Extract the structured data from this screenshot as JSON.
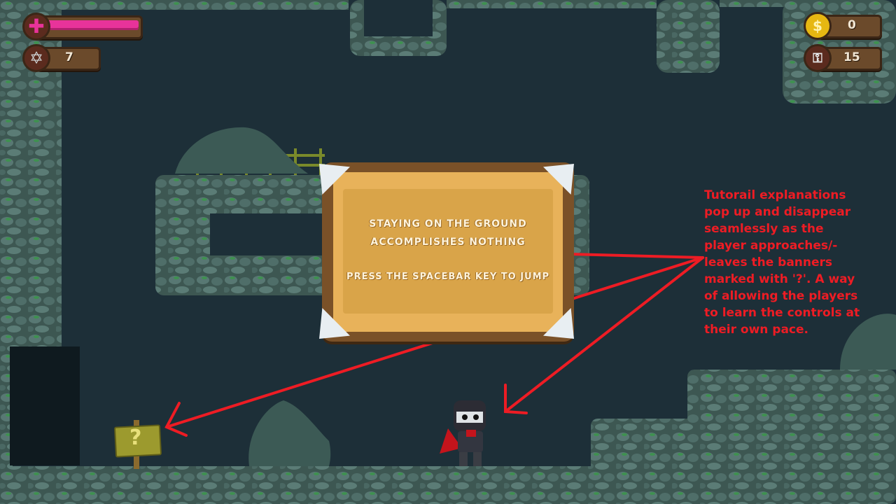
{
  "hud": {
    "health": {
      "icon": "plus-icon",
      "level": 1.0,
      "color": "#e8339a"
    },
    "shuriken": {
      "icon": "shuriken-icon",
      "count": "7"
    },
    "coins": {
      "icon": "coin-icon",
      "symbol": "$",
      "count": "0"
    },
    "keys": {
      "icon": "key-icon",
      "count": "15"
    }
  },
  "tutorial_banner": {
    "line1": "STAYING ON THE GROUND",
    "line2": "ACCOMPLISHES NOTHING",
    "line3": "PRESS THE SPACEBAR KEY TO JUMP"
  },
  "help_sign": {
    "symbol": "?"
  },
  "annotation": {
    "text": "Tutorail explanations\npop up and disappear\nseamlessly as the\nplayer approaches/-\nleaves the banners\nmarked with '?'. A way\nof allowing the players\nto learn the controls at\ntheir own pace.",
    "color": "#ee1c24"
  },
  "colors": {
    "background": "#1d2f38",
    "stone": "#4d6b66",
    "moss": "#3f8f4e",
    "wood": "#6b4a2b",
    "banner_paper": "#e8b25a"
  }
}
